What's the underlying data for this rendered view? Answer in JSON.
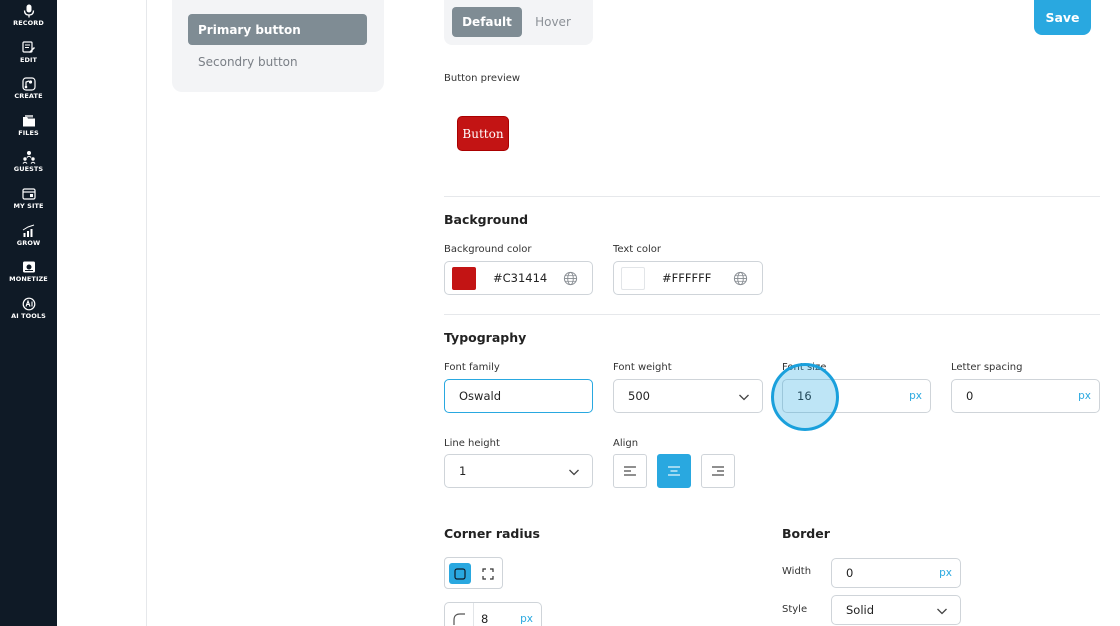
{
  "nav": {
    "items": [
      {
        "label": "RECORD",
        "icon": "mic-icon"
      },
      {
        "label": "EDIT",
        "icon": "edit-icon"
      },
      {
        "label": "CREATE",
        "icon": "create-icon"
      },
      {
        "label": "FILES",
        "icon": "files-icon"
      },
      {
        "label": "GUESTS",
        "icon": "guests-icon"
      },
      {
        "label": "MY SITE",
        "icon": "site-icon"
      },
      {
        "label": "GROW",
        "icon": "grow-icon"
      },
      {
        "label": "MONETIZE",
        "icon": "monetize-icon"
      },
      {
        "label": "AI TOOLS",
        "icon": "ai-icon"
      }
    ]
  },
  "button_list": {
    "items": [
      {
        "label": "Primary button",
        "active": true
      },
      {
        "label": "Secondry button",
        "active": false
      }
    ]
  },
  "state_tabs": [
    {
      "label": "Default",
      "active": true
    },
    {
      "label": "Hover",
      "active": false
    }
  ],
  "save_label": "Save",
  "preview": {
    "label": "Button preview",
    "button_text": "Button"
  },
  "background": {
    "heading": "Background",
    "bg_color_label": "Background color",
    "bg_color_value": "#C31414",
    "text_color_label": "Text color",
    "text_color_value": "#FFFFFF"
  },
  "typography": {
    "heading": "Typography",
    "font_family_label": "Font family",
    "font_family_value": "Oswald",
    "font_weight_label": "Font weight",
    "font_weight_value": "500",
    "font_size_label": "Font size",
    "font_size_value": "16",
    "font_size_unit": "px",
    "letter_spacing_label": "Letter spacing",
    "letter_spacing_value": "0",
    "letter_spacing_unit": "px",
    "line_height_label": "Line height",
    "line_height_value": "1",
    "align_label": "Align",
    "align_active": "center"
  },
  "corner": {
    "heading": "Corner radius",
    "radius_value": "8",
    "radius_unit": "px"
  },
  "border": {
    "heading": "Border",
    "width_label": "Width",
    "width_value": "0",
    "width_unit": "px",
    "style_label": "Style",
    "style_value": "Solid"
  },
  "colors": {
    "accent": "#29a8e0",
    "rail_bg": "#0f1a26",
    "active_tab": "#7f8c94",
    "preview_bg": "#C31414"
  }
}
